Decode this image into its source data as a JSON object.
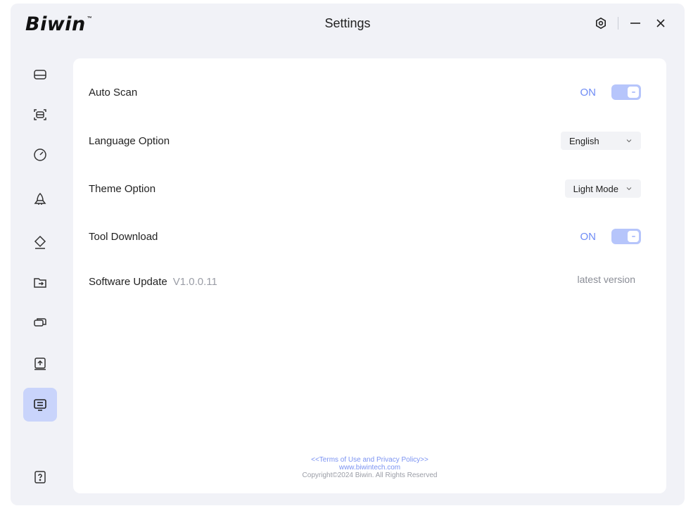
{
  "app": {
    "logo_text": "Biwin",
    "logo_tm": "™",
    "title": "Settings"
  },
  "title_controls": [
    {
      "name": "settings-icon"
    },
    {
      "name": "minimize-icon"
    },
    {
      "name": "close-icon"
    }
  ],
  "sidebar": {
    "items": [
      {
        "icon": "drive-icon"
      },
      {
        "icon": "scan-icon"
      },
      {
        "icon": "speed-gauge-icon"
      },
      {
        "icon": "rocket-icon"
      },
      {
        "icon": "eraser-icon"
      },
      {
        "icon": "folder-transfer-icon"
      },
      {
        "icon": "disk-clone-icon"
      },
      {
        "icon": "firmware-upload-icon"
      },
      {
        "icon": "settings-monitor-icon",
        "active": true
      }
    ],
    "help_icon": "help-icon"
  },
  "settings": {
    "auto_scan": {
      "label": "Auto Scan",
      "state": "ON"
    },
    "language": {
      "label": "Language Option",
      "value": "English"
    },
    "theme": {
      "label": "Theme Option",
      "value": "Light Mode"
    },
    "tool_download": {
      "label": "Tool Download",
      "state": "ON"
    },
    "software_update": {
      "label": "Software Update",
      "version": "V1.0.0.11",
      "status": "latest version"
    }
  },
  "footer": {
    "terms": "<<Terms of Use and Privacy Policy>>",
    "website": "www.biwintech.com",
    "copyright": "Copyright©2024 Biwin. All Rights Reserved"
  },
  "colors": {
    "accent": "#6f8cf5",
    "toggle_track": "#b6c5fb",
    "active_nav": "#c9d4fb",
    "window_bg": "#f1f2f7"
  }
}
